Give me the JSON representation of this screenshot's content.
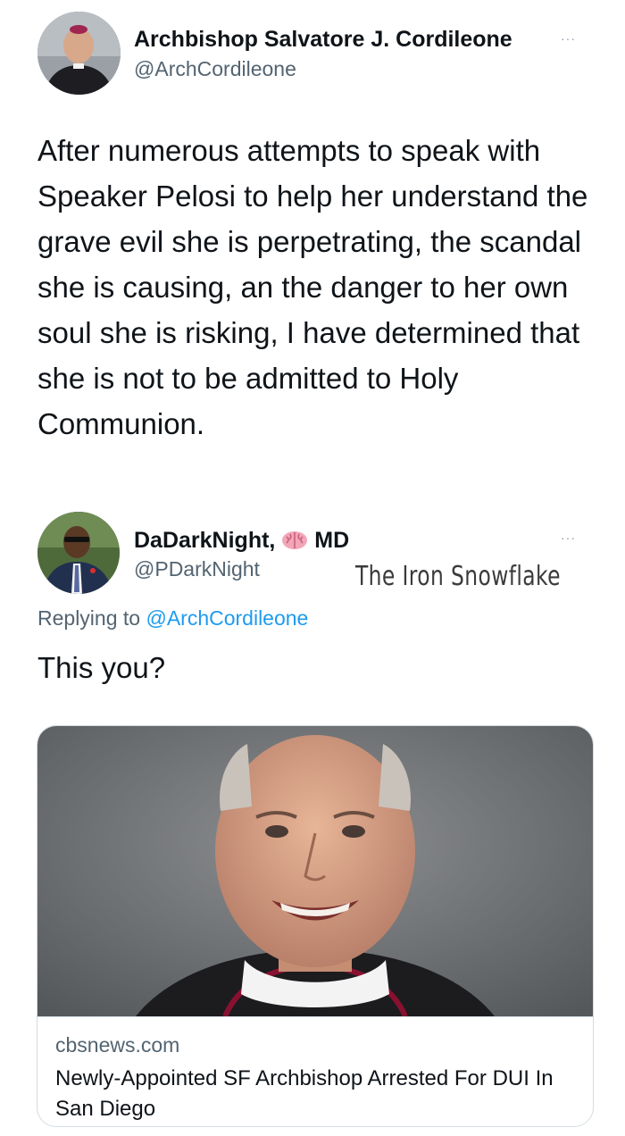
{
  "tweet1": {
    "author_name": "Archbishop Salvatore J. Cordileone",
    "author_handle": "@ArchCordileone",
    "more_label": "···",
    "text": "After numerous attempts to speak with Speaker Pelosi to help her understand the grave evil she is perpetrating, the scandal she is causing, an the danger to her own soul she is risking, I have determined that she is not to be admitted to Holy Communion."
  },
  "tweet2": {
    "author_name": "DaDarkNight,",
    "author_suffix": "MD",
    "author_handle": "@PDarkNight",
    "more_label": "···",
    "replying_prefix": "Replying to",
    "replying_handle": "@ArchCordileone",
    "text": "This you?"
  },
  "watermark": "The Iron Snowflake",
  "link_card": {
    "domain": "cbsnews.com",
    "headline": "Newly-Appointed SF Archbishop Arrested For DUI In San Diego"
  },
  "icons": {
    "brain": "brain-emoji-icon",
    "more": "more-options-icon"
  }
}
